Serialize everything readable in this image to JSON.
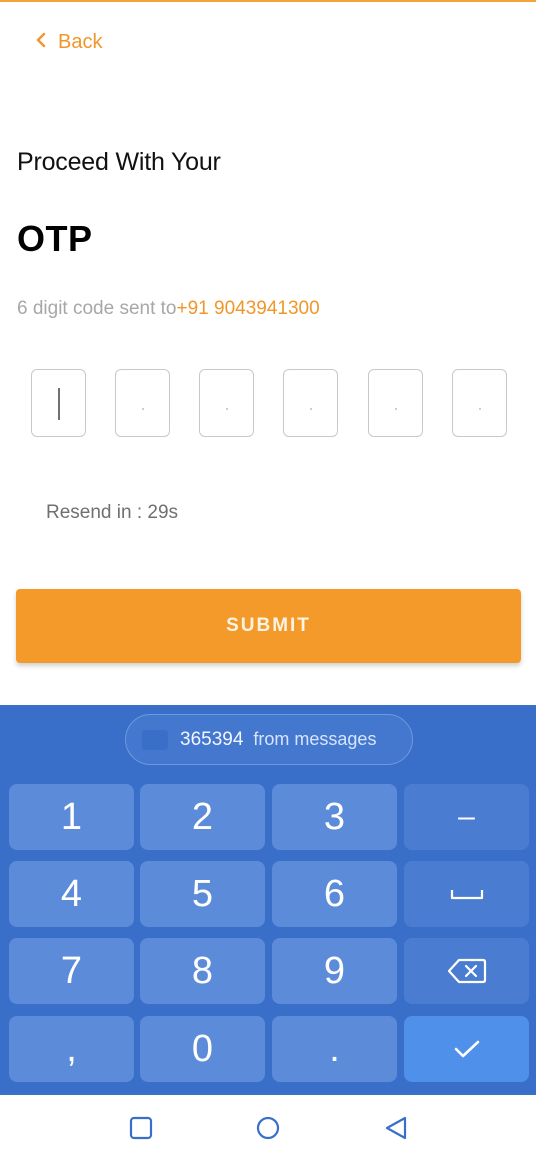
{
  "header": {
    "back_label": "Back"
  },
  "main": {
    "proceed_text": "Proceed With Your",
    "title": "OTP",
    "sent_prefix": "6 digit code sent to",
    "phone": "+91 9043941300",
    "otp_digits": [
      "",
      "",
      "",
      "",
      "",
      ""
    ],
    "resend_text": "Resend in : 29s",
    "submit_label": "SUBMIT"
  },
  "keyboard": {
    "suggestion_code": "365394",
    "suggestion_source": "from messages",
    "keys": [
      "1",
      "2",
      "3",
      "4",
      "5",
      "6",
      "7",
      "8",
      "9",
      ",",
      "0",
      "."
    ],
    "minus_key": "–"
  },
  "colors": {
    "accent": "#f39a2a",
    "keyboard_bg": "#3a6fc9",
    "key_bg": "#5c8cd9"
  },
  "icons": {
    "back": "chevron-left-icon",
    "space": "space-bar-icon",
    "backspace": "backspace-icon",
    "enter": "checkmark-icon",
    "nav_recent": "square-icon",
    "nav_home": "circle-icon",
    "nav_back": "triangle-back-icon"
  }
}
